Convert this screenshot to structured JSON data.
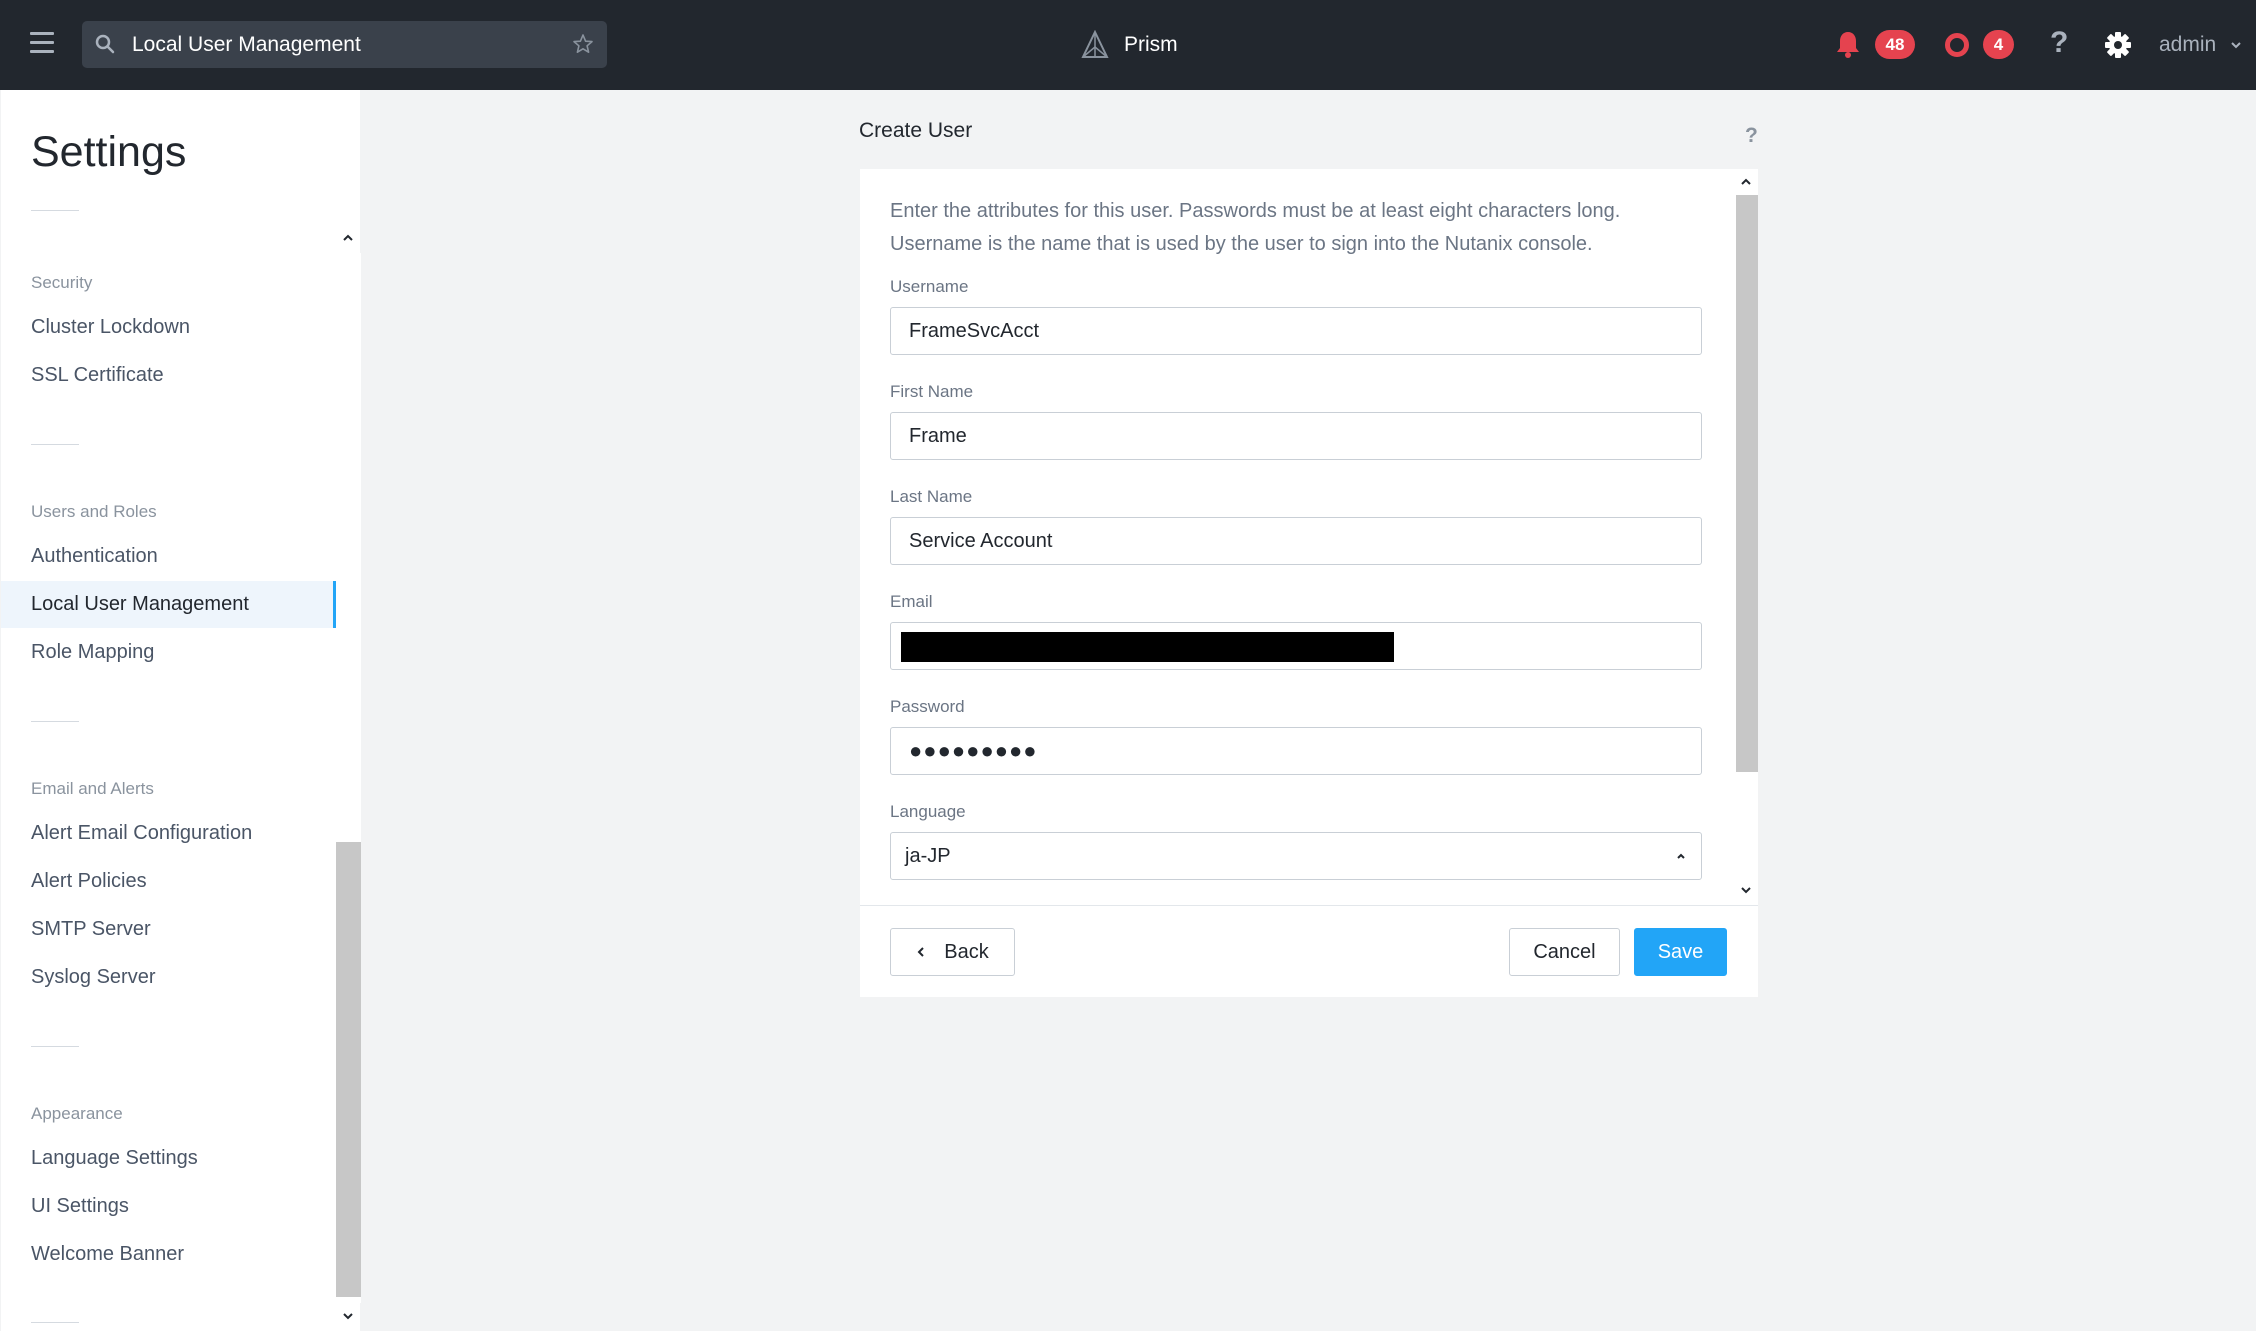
{
  "topbar": {
    "search_text": "Local User Management",
    "brand": "Prism",
    "alerts_count": "48",
    "events_count": "4",
    "help_glyph": "?",
    "user": "admin",
    "accent_color": "#e5434f",
    "icons": [
      "hamburger-menu-icon",
      "search-icon",
      "star-icon",
      "prism-logo-icon",
      "bell-icon",
      "ring-icon",
      "question-icon",
      "gear-icon",
      "chevron-down-icon"
    ]
  },
  "sidebar": {
    "title": "Settings",
    "groups": [
      {
        "label": "Security",
        "items": [
          "Cluster Lockdown",
          "SSL Certificate"
        ]
      },
      {
        "label": "Users and Roles",
        "items": [
          "Authentication",
          "Local User Management",
          "Role Mapping"
        ]
      },
      {
        "label": "Email and Alerts",
        "items": [
          "Alert Email Configuration",
          "Alert Policies",
          "SMTP Server",
          "Syslog Server"
        ]
      },
      {
        "label": "Appearance",
        "items": [
          "Language Settings",
          "UI Settings",
          "Welcome Banner"
        ]
      }
    ],
    "active_item": "Local User Management"
  },
  "dialog": {
    "title": "Create User",
    "help_glyph": "?",
    "intro": "Enter the attributes for this user. Passwords must be at least eight characters long. Username is the name that is used by the user to sign into the Nutanix console.",
    "fields": {
      "username": {
        "label": "Username",
        "value": "FrameSvcAcct"
      },
      "first_name": {
        "label": "First Name",
        "value": "Frame"
      },
      "last_name": {
        "label": "Last Name",
        "value": "Service Account"
      },
      "email": {
        "label": "Email",
        "value": ""
      },
      "password": {
        "label": "Password",
        "value": "●●●●●●●●●"
      },
      "language": {
        "label": "Language",
        "value": "ja-JP"
      }
    },
    "buttons": {
      "back": "Back",
      "cancel": "Cancel",
      "save": "Save"
    },
    "primary_color": "#22a5f7"
  }
}
